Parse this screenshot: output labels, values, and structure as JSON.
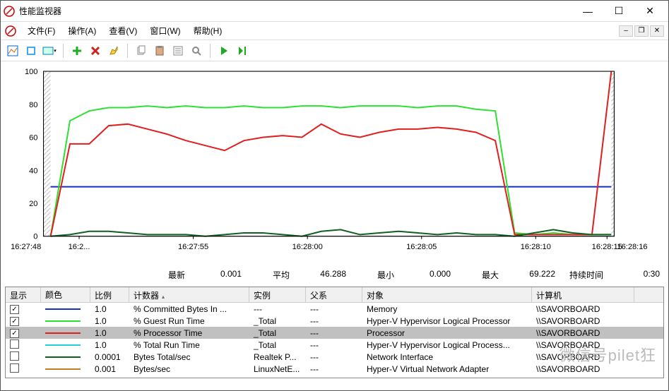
{
  "window": {
    "title": "性能监视器",
    "min": "—",
    "max": "☐",
    "close": "✕"
  },
  "menu": {
    "file": "文件(F)",
    "action": "操作(A)",
    "view": "查看(V)",
    "window": "窗口(W)",
    "help": "帮助(H)"
  },
  "stats": {
    "latest_label": "最新",
    "latest": "0.001",
    "avg_label": "平均",
    "avg": "46.288",
    "min_label": "最小",
    "min": "0.000",
    "max_label": "最大",
    "max": "69.222",
    "duration_label": "持续时间",
    "duration": "0:30"
  },
  "grid": {
    "headers": {
      "show": "显示",
      "color": "颜色",
      "scale": "比例",
      "counter": "计数器",
      "instance": "实例",
      "parent": "父系",
      "object": "对象",
      "computer": "计算机"
    },
    "rows": [
      {
        "checked": true,
        "color": "#1030c0",
        "scale": "1.0",
        "counter": "% Committed Bytes In ...",
        "instance": "---",
        "parent": "---",
        "object": "Memory",
        "computer": "\\\\SAVORBOARD",
        "selected": false
      },
      {
        "checked": true,
        "color": "#30e030",
        "scale": "1.0",
        "counter": "% Guest Run Time",
        "instance": "_Total",
        "parent": "---",
        "object": "Hyper-V Hypervisor Logical Processor",
        "computer": "\\\\SAVORBOARD",
        "selected": false
      },
      {
        "checked": true,
        "color": "#e02020",
        "scale": "1.0",
        "counter": "% Processor Time",
        "instance": "_Total",
        "parent": "---",
        "object": "Processor",
        "computer": "\\\\SAVORBOARD",
        "selected": true
      },
      {
        "checked": false,
        "color": "#20d0e0",
        "scale": "1.0",
        "counter": "% Total Run Time",
        "instance": "_Total",
        "parent": "---",
        "object": "Hyper-V Hypervisor Logical Process...",
        "computer": "\\\\SAVORBOARD",
        "selected": false
      },
      {
        "checked": false,
        "color": "#106020",
        "scale": "0.0001",
        "counter": "Bytes Total/sec",
        "instance": "Realtek P...",
        "parent": "---",
        "object": "Network Interface",
        "computer": "\\\\SAVORBOARD",
        "selected": false
      },
      {
        "checked": false,
        "color": "#c08020",
        "scale": "0.001",
        "counter": "Bytes/sec",
        "instance": "LinuxNetE...",
        "parent": "---",
        "object": "Hyper-V Virtual Network Adapter",
        "computer": "\\\\SAVORBOARD",
        "selected": false
      }
    ]
  },
  "chart_data": {
    "type": "line",
    "ylim": [
      0,
      100
    ],
    "yticks": [
      0,
      20,
      40,
      60,
      80,
      100
    ],
    "x_start_label": "16:27:48",
    "x_end_label": "16:28:16",
    "xticks": [
      "16:2...",
      "16:27:55",
      "16:28:00",
      "16:28:05",
      "16:28:10",
      "16:28:15"
    ],
    "series": [
      {
        "name": "% Committed Bytes In Use",
        "color": "#1030c0",
        "values": [
          30,
          30,
          30,
          30,
          30,
          30,
          30,
          30,
          30,
          30,
          30,
          30,
          30,
          30,
          30,
          30,
          30,
          30,
          30,
          30,
          30,
          30,
          30,
          30,
          30,
          30,
          30,
          30,
          30,
          30
        ]
      },
      {
        "name": "% Guest Run Time",
        "color": "#30e030",
        "values": [
          0,
          70,
          76,
          78,
          78,
          79,
          78,
          79,
          78,
          78,
          79,
          78,
          78,
          79,
          79,
          78,
          79,
          79,
          79,
          78,
          79,
          79,
          77,
          76,
          2,
          1,
          2,
          1,
          1,
          1
        ]
      },
      {
        "name": "% Processor Time",
        "color": "#e02020",
        "values": [
          0,
          56,
          56,
          67,
          68,
          65,
          62,
          58,
          55,
          52,
          58,
          60,
          61,
          60,
          68,
          62,
          60,
          63,
          65,
          65,
          66,
          65,
          63,
          58,
          1,
          1,
          1,
          1,
          1,
          100
        ]
      },
      {
        "name": "Bytes Total/sec",
        "color": "#106020",
        "values": [
          0,
          1,
          3,
          3,
          2,
          1,
          1,
          1,
          0,
          1,
          2,
          2,
          1,
          0,
          3,
          4,
          1,
          2,
          3,
          2,
          1,
          2,
          1,
          1,
          0,
          2,
          4,
          2,
          1,
          1
        ]
      }
    ]
  },
  "watermark": "微信号pilet狂"
}
